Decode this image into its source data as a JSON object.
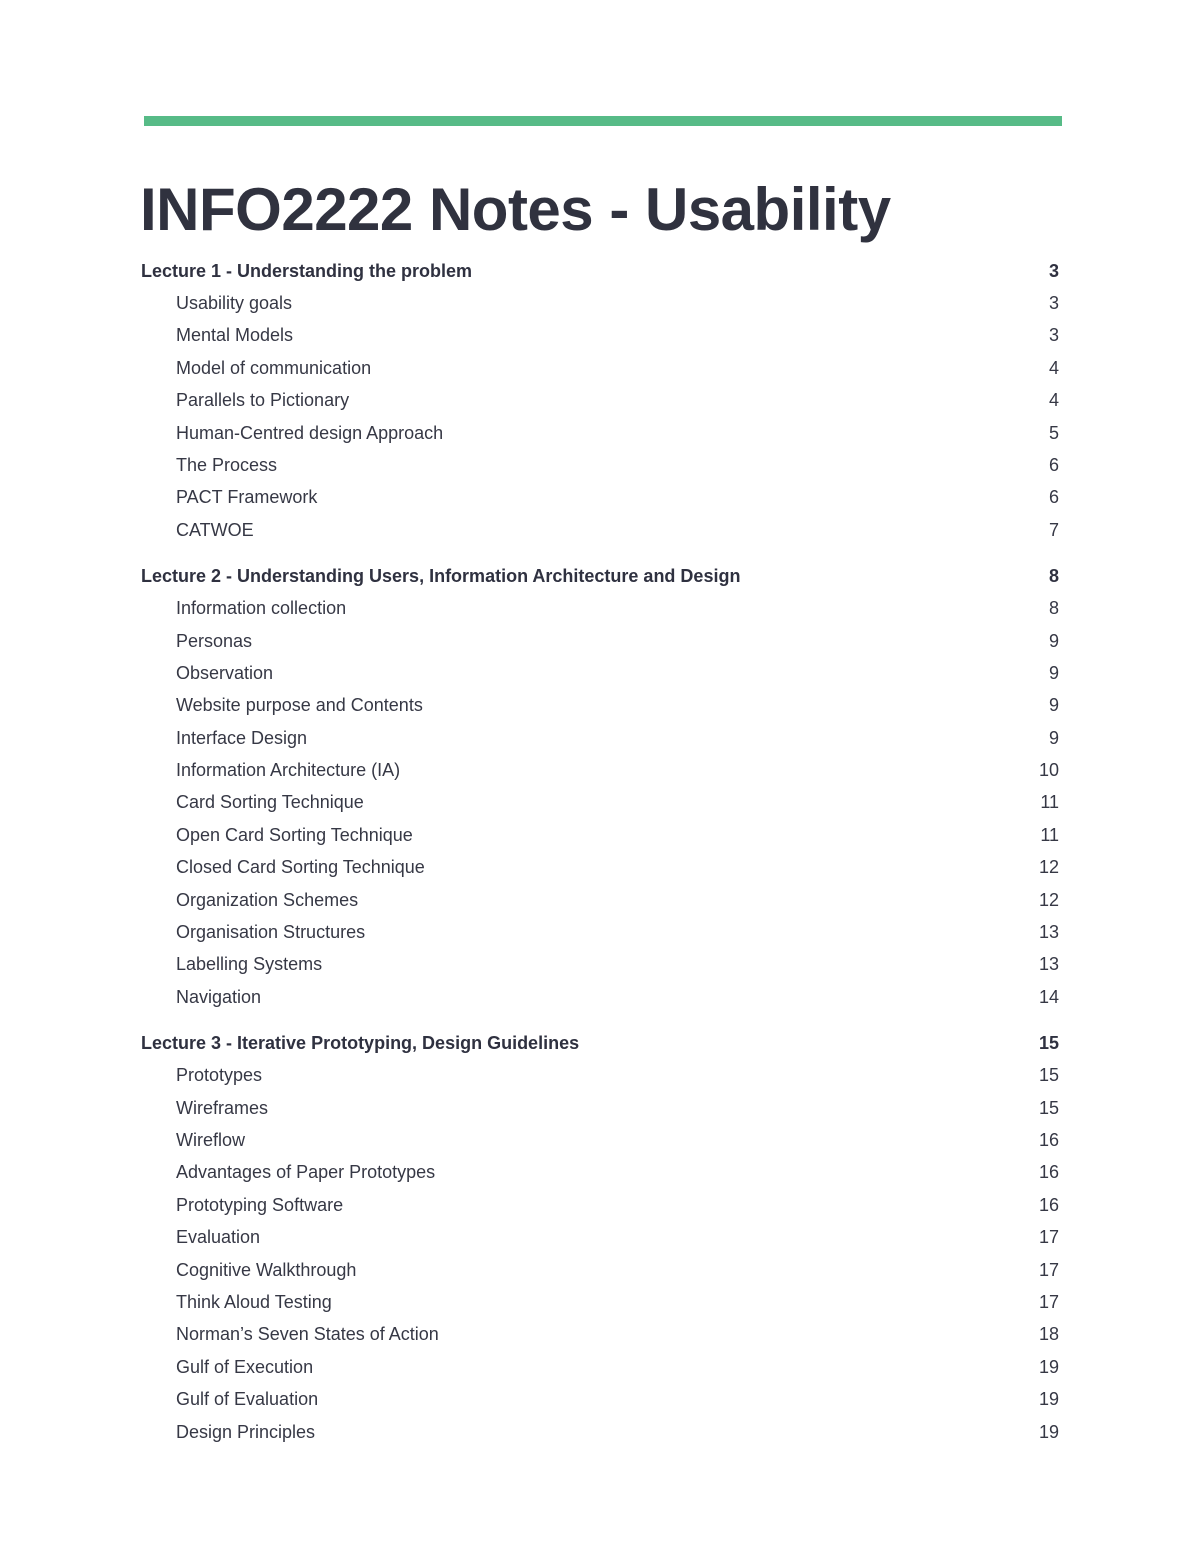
{
  "document": {
    "accent_color": "#57bb87",
    "title": "INFO2222 Notes - Usability"
  },
  "toc": [
    {
      "heading": "Lecture 1 - Understanding the problem",
      "page": "3",
      "items": [
        {
          "label": "Usability goals",
          "page": "3"
        },
        {
          "label": "Mental Models",
          "page": "3"
        },
        {
          "label": "Model of communication",
          "page": "4"
        },
        {
          "label": "Parallels to Pictionary",
          "page": "4"
        },
        {
          "label": "Human-Centred design Approach",
          "page": "5"
        },
        {
          "label": "The Process",
          "page": "6"
        },
        {
          "label": "PACT Framework",
          "page": "6"
        },
        {
          "label": "CATWOE",
          "page": "7"
        }
      ]
    },
    {
      "heading": "Lecture 2 - Understanding Users, Information Architecture and Design",
      "page": "8",
      "items": [
        {
          "label": "Information collection",
          "page": "8"
        },
        {
          "label": "Personas",
          "page": "9"
        },
        {
          "label": "Observation",
          "page": "9"
        },
        {
          "label": "Website purpose and Contents",
          "page": "9"
        },
        {
          "label": "Interface Design",
          "page": "9"
        },
        {
          "label": "Information Architecture (IA)",
          "page": "10"
        },
        {
          "label": "Card Sorting Technique",
          "page": "11"
        },
        {
          "label": "Open Card Sorting Technique",
          "page": "11"
        },
        {
          "label": "Closed Card Sorting Technique",
          "page": "12"
        },
        {
          "label": "Organization Schemes",
          "page": "12"
        },
        {
          "label": "Organisation Structures",
          "page": "13"
        },
        {
          "label": "Labelling Systems",
          "page": "13"
        },
        {
          "label": "Navigation",
          "page": "14"
        }
      ]
    },
    {
      "heading": "Lecture 3 - Iterative Prototyping, Design Guidelines",
      "page": "15",
      "items": [
        {
          "label": "Prototypes",
          "page": "15"
        },
        {
          "label": "Wireframes",
          "page": "15"
        },
        {
          "label": "Wireflow",
          "page": "16"
        },
        {
          "label": "Advantages of Paper Prototypes",
          "page": "16"
        },
        {
          "label": "Prototyping Software",
          "page": "16"
        },
        {
          "label": "Evaluation",
          "page": "17"
        },
        {
          "label": "Cognitive Walkthrough",
          "page": "17"
        },
        {
          "label": "Think Aloud Testing",
          "page": "17"
        },
        {
          "label": "Norman’s Seven States of Action",
          "page": "18"
        },
        {
          "label": "Gulf of Execution",
          "page": "19"
        },
        {
          "label": "Gulf of Evaluation",
          "page": "19"
        },
        {
          "label": "Design Principles",
          "page": "19"
        }
      ]
    }
  ]
}
